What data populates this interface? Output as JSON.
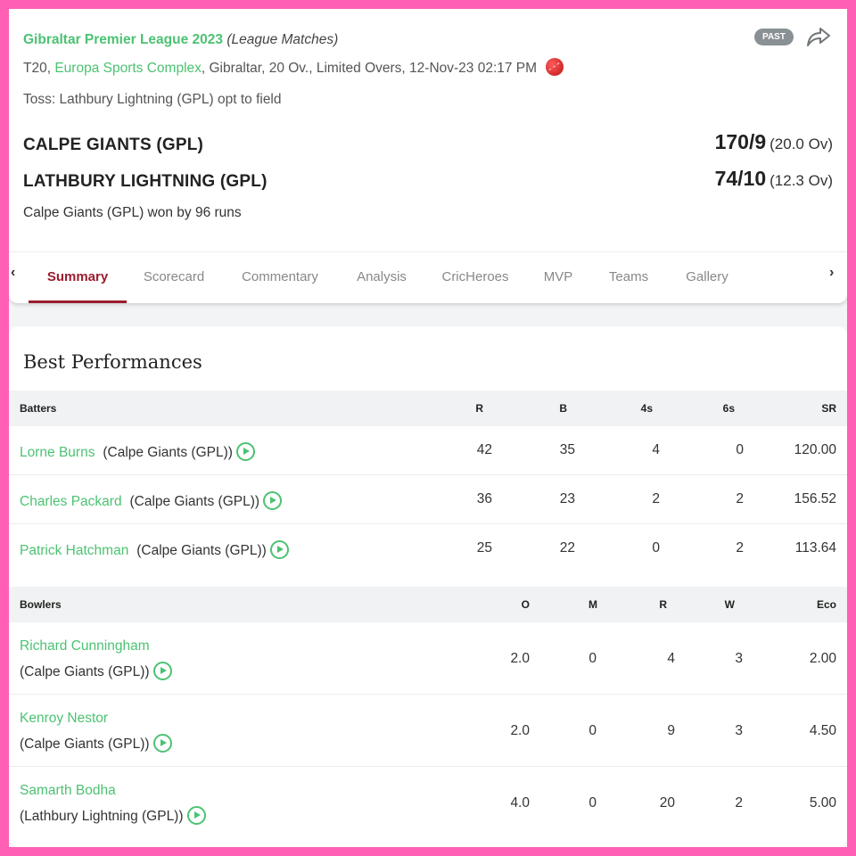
{
  "match": {
    "league": "Gibraltar Premier League 2023",
    "match_type": "(League Matches)",
    "status_badge": "PAST",
    "format": "T20,",
    "venue": "Europa Sports Complex",
    "details": ", Gibraltar, 20 Ov., Limited Overs, 12-Nov-23 02:17 PM",
    "toss": "Toss: Lathbury Lightning (GPL) opt to field",
    "teams": [
      {
        "name": "CALPE GIANTS (GPL)",
        "score": "170/9",
        "overs": "(20.0 Ov)"
      },
      {
        "name": "LATHBURY LIGHTNING (GPL)",
        "score": "74/10",
        "overs": "(12.3 Ov)"
      }
    ],
    "result": "Calpe Giants (GPL) won by 96 runs"
  },
  "tabs": {
    "prev_arrow": "‹",
    "next_arrow": "›",
    "items": [
      "Summary",
      "Scorecard",
      "Commentary",
      "Analysis",
      "CricHeroes",
      "MVP",
      "Teams",
      "Gallery"
    ],
    "active": "Summary"
  },
  "best_performances": {
    "title": "Best Performances",
    "batters": {
      "headers": [
        "Batters",
        "R",
        "B",
        "4s",
        "6s",
        "SR"
      ],
      "rows": [
        {
          "name": "Lorne Burns",
          "team": "(Calpe Giants (GPL))",
          "r": "42",
          "b": "35",
          "fours": "4",
          "sixes": "0",
          "sr": "120.00"
        },
        {
          "name": "Charles Packard",
          "team": "(Calpe Giants (GPL))",
          "r": "36",
          "b": "23",
          "fours": "2",
          "sixes": "2",
          "sr": "156.52"
        },
        {
          "name": "Patrick Hatchman",
          "team": "(Calpe Giants (GPL))",
          "r": "25",
          "b": "22",
          "fours": "0",
          "sixes": "2",
          "sr": "113.64"
        }
      ]
    },
    "bowlers": {
      "headers": [
        "Bowlers",
        "O",
        "M",
        "R",
        "W",
        "Eco"
      ],
      "rows": [
        {
          "name": "Richard Cunningham",
          "team": "(Calpe Giants (GPL))",
          "o": "2.0",
          "m": "0",
          "r": "4",
          "w": "3",
          "eco": "2.00"
        },
        {
          "name": "Kenroy Nestor",
          "team": "(Calpe Giants (GPL))",
          "o": "2.0",
          "m": "0",
          "r": "9",
          "w": "3",
          "eco": "4.50"
        },
        {
          "name": "Samarth Bodha",
          "team": "(Lathbury Lightning (GPL))",
          "o": "4.0",
          "m": "0",
          "r": "20",
          "w": "2",
          "eco": "5.00"
        }
      ]
    }
  },
  "icons": [
    "share-icon",
    "cricket-ball-icon",
    "play-icon",
    "chevron-left-icon",
    "chevron-right-icon"
  ],
  "colors": {
    "frame": "#ff5fb4",
    "accent_green": "#4cc272",
    "active_tab": "#9b1c2e",
    "badge": "#8a9194"
  }
}
